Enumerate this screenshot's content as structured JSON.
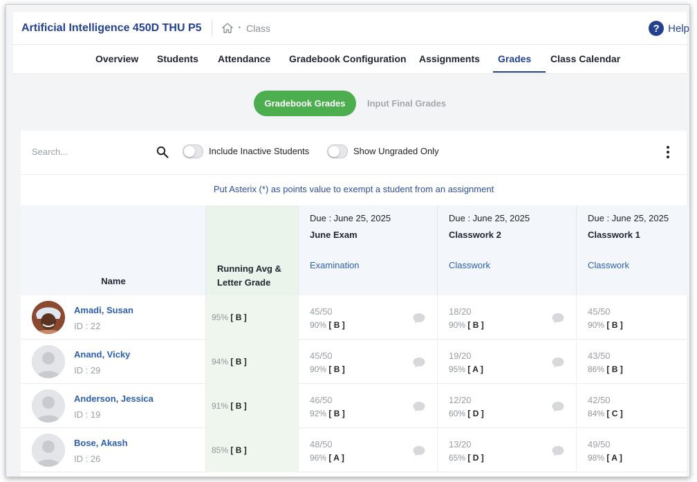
{
  "header": {
    "class_title": "Artificial Intelligence 450D THU P5",
    "breadcrumb_sep": "•",
    "breadcrumb_current": "Class",
    "help_glyph": "?",
    "help_label": "Help"
  },
  "nav": {
    "tabs": [
      {
        "label": "Overview"
      },
      {
        "label": "Students"
      },
      {
        "label": "Attendance"
      },
      {
        "label": "Gradebook Configuration"
      },
      {
        "label": "Assignments"
      },
      {
        "label": "Grades",
        "active": true
      },
      {
        "label": "Class Calendar"
      }
    ]
  },
  "subnav": {
    "primary": "Gradebook Grades",
    "secondary": "Input Final Grades"
  },
  "toolbar": {
    "search_placeholder": "Search...",
    "toggle_inactive": "Include Inactive Students",
    "toggle_ungraded": "Show Ungraded Only"
  },
  "notice": "Put Asterix (*) as points value to exempt a student from an assignment",
  "table": {
    "name_header": "Name",
    "avg_header": [
      "Running Avg &",
      "Letter Grade"
    ],
    "assignments": [
      {
        "due": "Due : June 25, 2025",
        "title": "June Exam",
        "type": "Examination"
      },
      {
        "due": "Due : June 25, 2025",
        "title": "Classwork 2",
        "type": "Classwork"
      },
      {
        "due": "Due : June 25, 2025",
        "title": "Classwork 1",
        "type": "Classwork"
      }
    ],
    "rows": [
      {
        "name": "Amadi, Susan",
        "id": "ID : 22",
        "photo": true,
        "avg": "95%",
        "avg_letter": "[ B ]",
        "grades": [
          {
            "points": "45/50",
            "pct": "90%",
            "letter": "[ B ]"
          },
          {
            "points": "18/20",
            "pct": "90%",
            "letter": "[ B ]"
          },
          {
            "points": "45/50",
            "pct": "90%",
            "letter": "[ B ]"
          }
        ]
      },
      {
        "name": "Anand, Vicky",
        "id": "ID : 29",
        "photo": false,
        "avg": "94%",
        "avg_letter": "[ B ]",
        "grades": [
          {
            "points": "45/50",
            "pct": "90%",
            "letter": "[ B ]"
          },
          {
            "points": "19/20",
            "pct": "95%",
            "letter": "[ A ]"
          },
          {
            "points": "43/50",
            "pct": "86%",
            "letter": "[ B ]"
          }
        ]
      },
      {
        "name": "Anderson, Jessica",
        "id": "ID : 19",
        "photo": false,
        "avg": "91%",
        "avg_letter": "[ B ]",
        "grades": [
          {
            "points": "46/50",
            "pct": "92%",
            "letter": "[ B ]"
          },
          {
            "points": "12/20",
            "pct": "60%",
            "letter": "[ D ]"
          },
          {
            "points": "42/50",
            "pct": "84%",
            "letter": "[ C ]"
          }
        ]
      },
      {
        "name": "Bose, Akash",
        "id": "ID : 26",
        "photo": false,
        "avg": "85%",
        "avg_letter": "[ B ]",
        "grades": [
          {
            "points": "48/50",
            "pct": "96%",
            "letter": "[ A ]"
          },
          {
            "points": "13/20",
            "pct": "65%",
            "letter": "[ D ]"
          },
          {
            "points": "49/50",
            "pct": "98%",
            "letter": "[ A ]"
          }
        ]
      }
    ]
  },
  "colors": {
    "brand": "#23418f",
    "link": "#2c5fb0",
    "accent_green": "#4cae4f",
    "avg_column_bg": "#eef6ee"
  },
  "icons": [
    "home-icon",
    "help-icon",
    "search-icon",
    "kebab-menu-icon",
    "comment-icon",
    "avatar-placeholder-icon"
  ]
}
